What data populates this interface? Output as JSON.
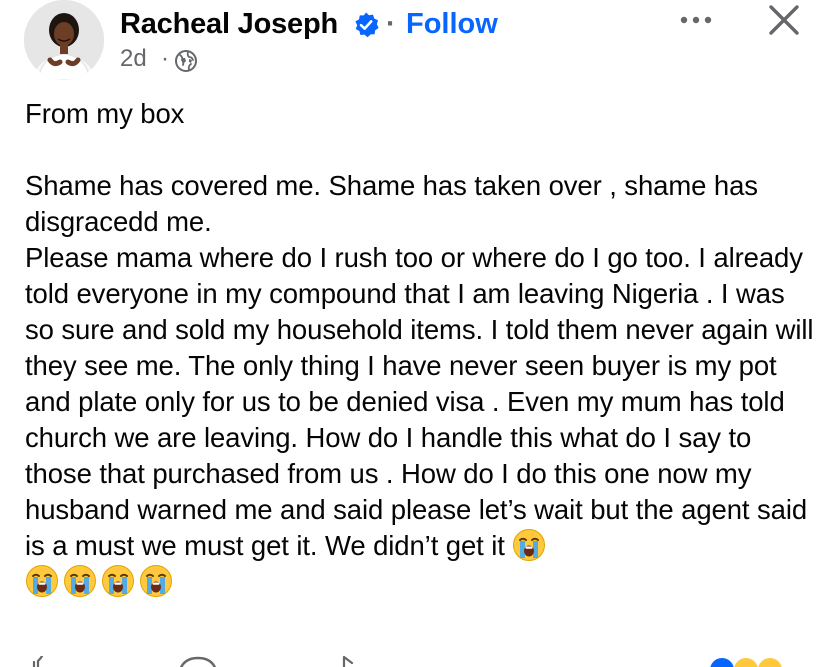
{
  "header": {
    "author_name": "Racheal Joseph",
    "separator": "·",
    "follow_label": "Follow",
    "timestamp": "2d",
    "time_separator": "·",
    "verified_icon": "verified-badge-icon",
    "audience_icon": "globe-icon",
    "more_icon": "more-options-icon",
    "close_icon": "close-icon"
  },
  "post": {
    "paragraph_1": "From my box",
    "paragraph_2": "Shame has covered me. Shame has taken over , shame has disgracedd me.",
    "paragraph_3": "Please mama where do I rush too or where do I go too. I already told everyone in my compound that I am leaving Nigeria . I was so sure and sold my household items. I told them never again will they see me. The only thing I have never seen buyer is my pot and plate only for us to be denied visa . Even my mum has told church we are leaving. How do I handle this what do I say to those that purchased from us . How do I do this one now my husband warned me and said please let’s wait but the agent said is a must we must get it. We didn’t get it",
    "emojis": [
      "loudly-crying-face",
      "loudly-crying-face",
      "loudly-crying-face",
      "loudly-crying-face",
      "loudly-crying-face"
    ]
  },
  "colors": {
    "accent": "#0866ff",
    "text": "#050505",
    "secondary_text": "#65676b"
  },
  "actions": {
    "icons": [
      "like-icon",
      "comment-icon",
      "share-icon",
      "reactions-icon"
    ]
  }
}
